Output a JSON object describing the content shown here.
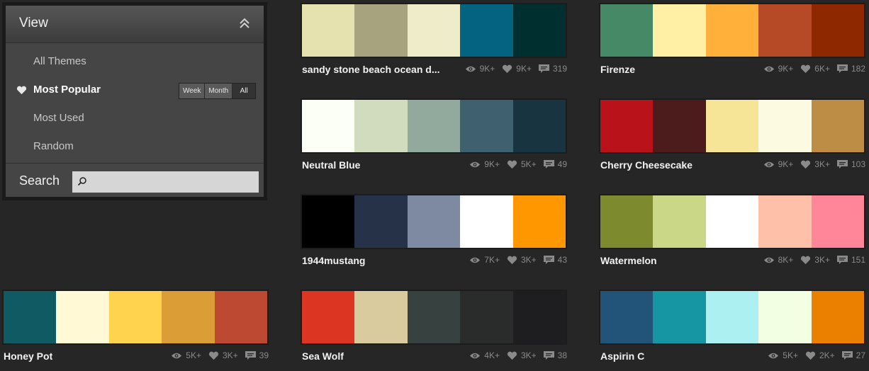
{
  "sidebar": {
    "title": "View",
    "items": [
      {
        "label": "All Themes"
      },
      {
        "label": "Most Popular"
      },
      {
        "label": "Most Used"
      },
      {
        "label": "Random"
      }
    ],
    "filters": [
      "Week",
      "Month",
      "All"
    ],
    "search_label": "Search",
    "search_value": ""
  },
  "themes": [
    {
      "name": "sandy stone beach ocean d...",
      "views": "9K+",
      "likes": "9K+",
      "comments": "319",
      "colors": [
        "#e6e2b0",
        "#a7a37e",
        "#efecca",
        "#046380",
        "#002f2f"
      ]
    },
    {
      "name": "Firenze",
      "views": "9K+",
      "likes": "6K+",
      "comments": "182",
      "colors": [
        "#468966",
        "#fff0a5",
        "#ffb03b",
        "#b64926",
        "#8e2800"
      ]
    },
    {
      "name": "Neutral Blue",
      "views": "9K+",
      "likes": "5K+",
      "comments": "49",
      "colors": [
        "#fcfff5",
        "#d1dbbd",
        "#91aa9d",
        "#3e606f",
        "#193441"
      ]
    },
    {
      "name": "Cherry Cheesecake",
      "views": "9K+",
      "likes": "3K+",
      "comments": "103",
      "colors": [
        "#b9121b",
        "#4c1b1b",
        "#f6e497",
        "#fcfae1",
        "#bd8d46"
      ]
    },
    {
      "name": "1944mustang",
      "views": "7K+",
      "likes": "3K+",
      "comments": "43",
      "colors": [
        "#000000",
        "#263248",
        "#7e8aa2",
        "#ffffff",
        "#ff9800"
      ]
    },
    {
      "name": "Watermelon",
      "views": "8K+",
      "likes": "3K+",
      "comments": "151",
      "colors": [
        "#7d8a2e",
        "#c9d787",
        "#ffffff",
        "#ffc0a9",
        "#ff8598"
      ]
    },
    {
      "name": "Honey Pot",
      "views": "5K+",
      "likes": "3K+",
      "comments": "39",
      "colors": [
        "#105b63",
        "#fffad5",
        "#ffd34e",
        "#db9e36",
        "#bd4932"
      ]
    },
    {
      "name": "Sea Wolf",
      "views": "4K+",
      "likes": "3K+",
      "comments": "38",
      "colors": [
        "#dc3522",
        "#d9cb9e",
        "#374140",
        "#2a2c2b",
        "#1e1e20"
      ]
    },
    {
      "name": "Aspirin C",
      "views": "5K+",
      "likes": "2K+",
      "comments": "27",
      "colors": [
        "#225378",
        "#1695a3",
        "#acf0f2",
        "#f3ffe2",
        "#eb7f00"
      ]
    }
  ]
}
